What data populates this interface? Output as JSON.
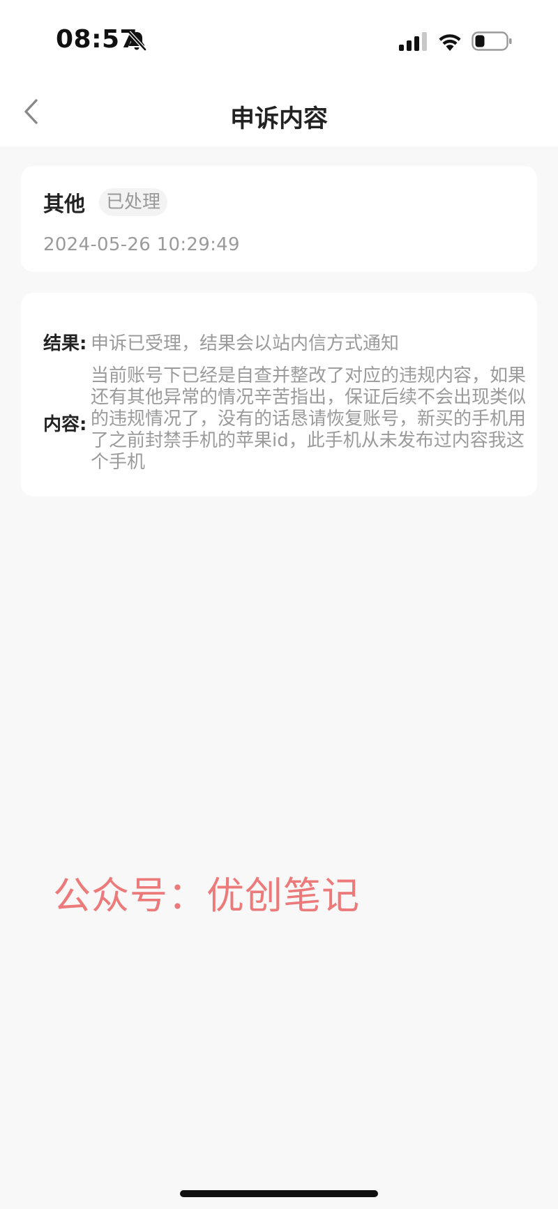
{
  "status_bar": {
    "time": "08:57",
    "icons": [
      "bell-slash-icon",
      "signal-icon",
      "wifi-icon",
      "battery-icon"
    ]
  },
  "nav": {
    "title": "申诉内容",
    "back_icon": "chevron-left-icon"
  },
  "summary": {
    "type": "其他",
    "status": "已处理",
    "datetime": "2024-05-26 10:29:49"
  },
  "detail": {
    "result_label": "结果:",
    "result_value": "申诉已受理，结果会以站内信方式通知",
    "content_label": "内容:",
    "content_value": "当前账号下已经是自查并整改了对应的违规内容，如果还有其他异常的情况辛苦指出，保证后续不会出现类似的违规情况了，没有的话恳请恢复账号，新买的手机用了之前封禁手机的苹果id，此手机从未发布过内容我这个手机"
  },
  "watermark": "公众号：优创笔记",
  "colors": {
    "background": "#f8f8f8",
    "card": "#ffffff",
    "muted_text": "#9a9a9a",
    "watermark": "#ec7a7a"
  }
}
